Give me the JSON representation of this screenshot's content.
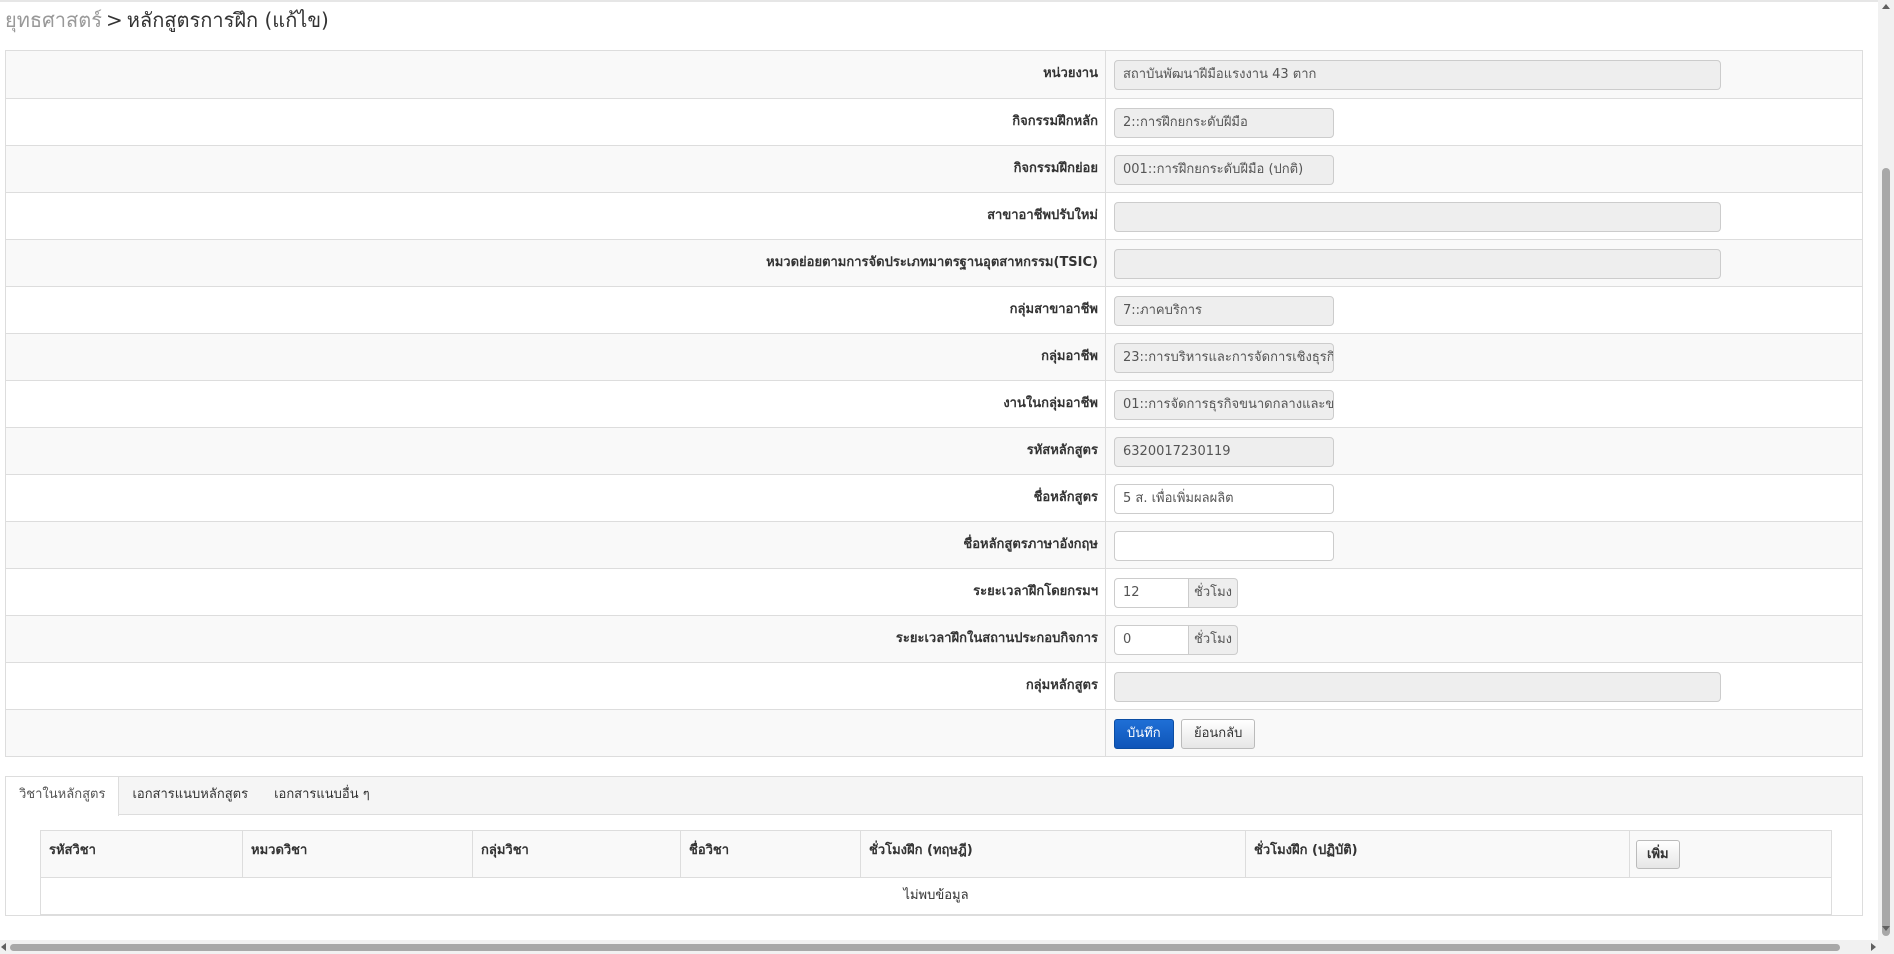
{
  "breadcrumb": {
    "root": "ยุทธศาสตร์",
    "separator": ">",
    "current": "หลักสูตรการฝึก (แก้ไข)"
  },
  "form": {
    "rows": [
      {
        "label": "หน่วยงาน",
        "value": "สถาบันพัฒนาฝีมือแรงงาน 43 ตาก"
      },
      {
        "label": "กิจกรรมฝึกหลัก",
        "value": "2::การฝึกยกระดับฝีมือ"
      },
      {
        "label": "กิจกรรมฝึกย่อย",
        "value": "001::การฝึกยกระดับฝีมือ (ปกติ)"
      },
      {
        "label": "สาขาอาชีพปรับใหม่",
        "value": ""
      },
      {
        "label": "หมวดย่อยตามการจัดประเภทมาตรฐานอุตสาหกรรม(TSIC)",
        "value": ""
      },
      {
        "label": "กลุ่มสาขาอาชีพ",
        "value": "7::ภาคบริการ"
      },
      {
        "label": "กลุ่มอาชีพ",
        "value": "23::การบริหารและการจัดการเชิงธุรกิ"
      },
      {
        "label": "งานในกลุ่มอาชีพ",
        "value": "01::การจัดการธุรกิจขนาดกลางและข"
      },
      {
        "label": "รหัสหลักสูตร",
        "value": "6320017230119"
      },
      {
        "label": "ชื่อหลักสูตร",
        "value": "5 ส. เพื่อเพิ่มผลผลิต"
      },
      {
        "label": "ชื่อหลักสูตรภาษาอังกฤษ",
        "value": ""
      },
      {
        "label": "ระยะเวลาฝึกโดยกรมฯ",
        "value": "12",
        "unit": "ชั่วโมง"
      },
      {
        "label": "ระยะเวลาฝึกในสถานประกอบกิจการ",
        "value": "0",
        "unit": "ชั่วโมง"
      },
      {
        "label": "กลุ่มหลักสูตร",
        "value": ""
      }
    ],
    "save_label": "บันทึก",
    "back_label": "ย้อนกลับ"
  },
  "tabs": [
    {
      "label": "วิชาในหลักสูตร",
      "active": true
    },
    {
      "label": "เอกสารแนบหลักสูตร",
      "active": false
    },
    {
      "label": "เอกสารแนบอื่น ๆ",
      "active": false
    }
  ],
  "subjects_table": {
    "headers": [
      "รหัสวิชา",
      "หมวดวิชา",
      "กลุ่มวิชา",
      "ชื่อวิชา",
      "ชั่วโมงฝึก (ทฤษฎี)",
      "ชั่วโมงฝึก (ปฏิบัติ)"
    ],
    "add_label": "เพิ่ม",
    "empty_text": "ไม่พบข้อมูล"
  },
  "colors": {
    "primary_button": "#0f55b8",
    "readonly_input": "#eeeeee",
    "border": "#dddddd",
    "striped_row": "#f9f9f9"
  }
}
